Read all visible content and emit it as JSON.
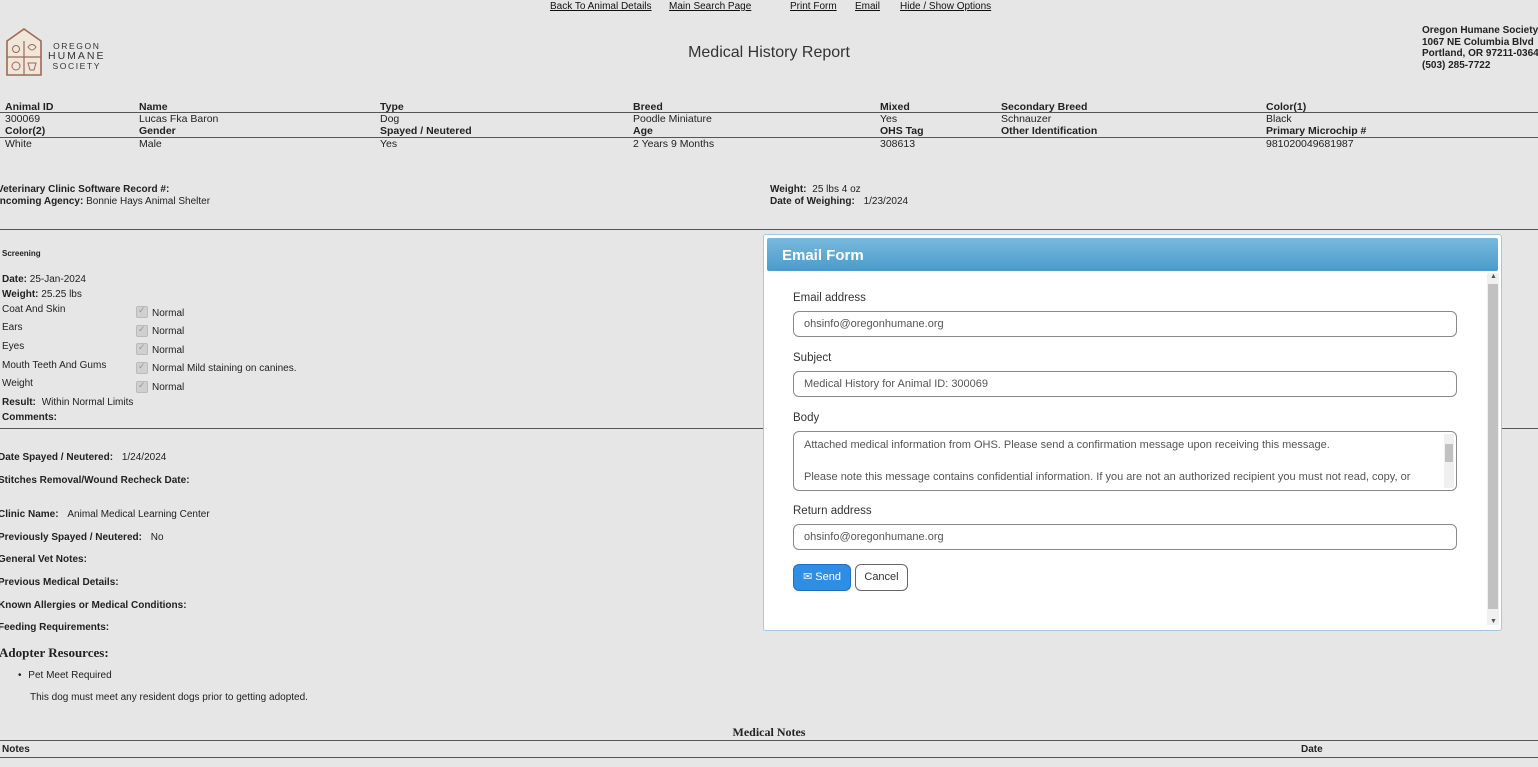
{
  "toplinks": [
    "Back To Animal Details",
    "Main Search Page",
    "Print Form",
    "Email",
    "Hide / Show Options"
  ],
  "logo": {
    "line1": "OREGON",
    "line2": "HUMANE",
    "line3": "SOCIETY"
  },
  "title": "Medical History Report",
  "address": [
    "Oregon Humane Society",
    "1067 NE Columbia Blvd",
    "Portland, OR 97211-0364",
    "(503) 285-7722"
  ],
  "animal": {
    "row1_headers": [
      "Animal ID",
      "Name",
      "Type",
      "Breed",
      "Mixed",
      "Secondary Breed",
      "Color(1)"
    ],
    "row1_values": [
      "300069",
      "Lucas Fka Baron",
      "Dog",
      "Poodle Miniature",
      "Yes",
      "Schnauzer",
      "Black"
    ],
    "row2_headers": [
      "Color(2)",
      "Gender",
      "Spayed / Neutered",
      "Age",
      "OHS Tag",
      "Other Identification",
      "Primary Microchip #"
    ],
    "row2_values": [
      "White",
      "Male",
      "Yes",
      "2 Years 9 Months",
      "308613",
      "",
      "981020049681987"
    ]
  },
  "record": {
    "vet_label": "Veterinary Clinic Software Record #:",
    "agency_label": "Incoming Agency:",
    "agency_value": "Bonnie Hays Animal Shelter",
    "weight_label": "Weight:",
    "weight_value": "25 lbs 4 oz",
    "weigh_date_label": "Date of Weighing:",
    "weigh_date_value": "1/23/2024"
  },
  "screening": {
    "heading": "Screening",
    "date_label": "Date:",
    "date_value": "25-Jan-2024",
    "weight_label": "Weight:",
    "weight_value": "25.25 lbs",
    "items": [
      {
        "name": "Coat And Skin",
        "status": "Normal",
        "note": ""
      },
      {
        "name": "Ears",
        "status": "Normal",
        "note": ""
      },
      {
        "name": "Eyes",
        "status": "Normal",
        "note": ""
      },
      {
        "name": "Mouth Teeth And Gums",
        "status": "Normal",
        "note": "Mild staining on canines."
      },
      {
        "name": "Weight",
        "status": "Normal",
        "note": ""
      }
    ],
    "result_label": "Result:",
    "result_value": "Within Normal Limits",
    "comments_label": "Comments:"
  },
  "surgery": {
    "spay_date_label": "Date Spayed / Neutered:",
    "spay_date_value": "1/24/2024",
    "stitches_label": "Stitches Removal/Wound Recheck Date:",
    "clinic_label": "Clinic Name:",
    "clinic_value": "Animal Medical Learning Center",
    "prev_spay_label": "Previously Spayed / Neutered:",
    "prev_spay_value": "No",
    "vet_notes_label": "General Vet Notes:",
    "prev_med_label": "Previous Medical Details:",
    "allergies_label": "Known Allergies or Medical Conditions:",
    "feeding_label": "Feeding Requirements:"
  },
  "adopter": {
    "heading": "Adopter Resources:",
    "items": [
      "Pet Meet Required"
    ],
    "note": "This dog must meet any resident dogs prior to getting adopted."
  },
  "medical_notes": {
    "heading": "Medical Notes",
    "col_notes": "Notes",
    "col_date": "Date"
  },
  "email_form": {
    "title": "Email Form",
    "email_label": "Email address",
    "email_value": "ohsinfo@oregonhumane.org",
    "subject_label": "Subject",
    "subject_value": "Medical History for Animal ID: 300069",
    "body_label": "Body",
    "body_line1": "Attached medical information from OHS. Please send a confirmation message upon receiving this message.",
    "body_line2": "Please note this message contains confidential information. If you are not an authorized recipient you must not read, copy, or",
    "return_label": "Return address",
    "return_value": "ohsinfo@oregonhumane.org",
    "send_label": "Send",
    "cancel_label": "Cancel"
  }
}
